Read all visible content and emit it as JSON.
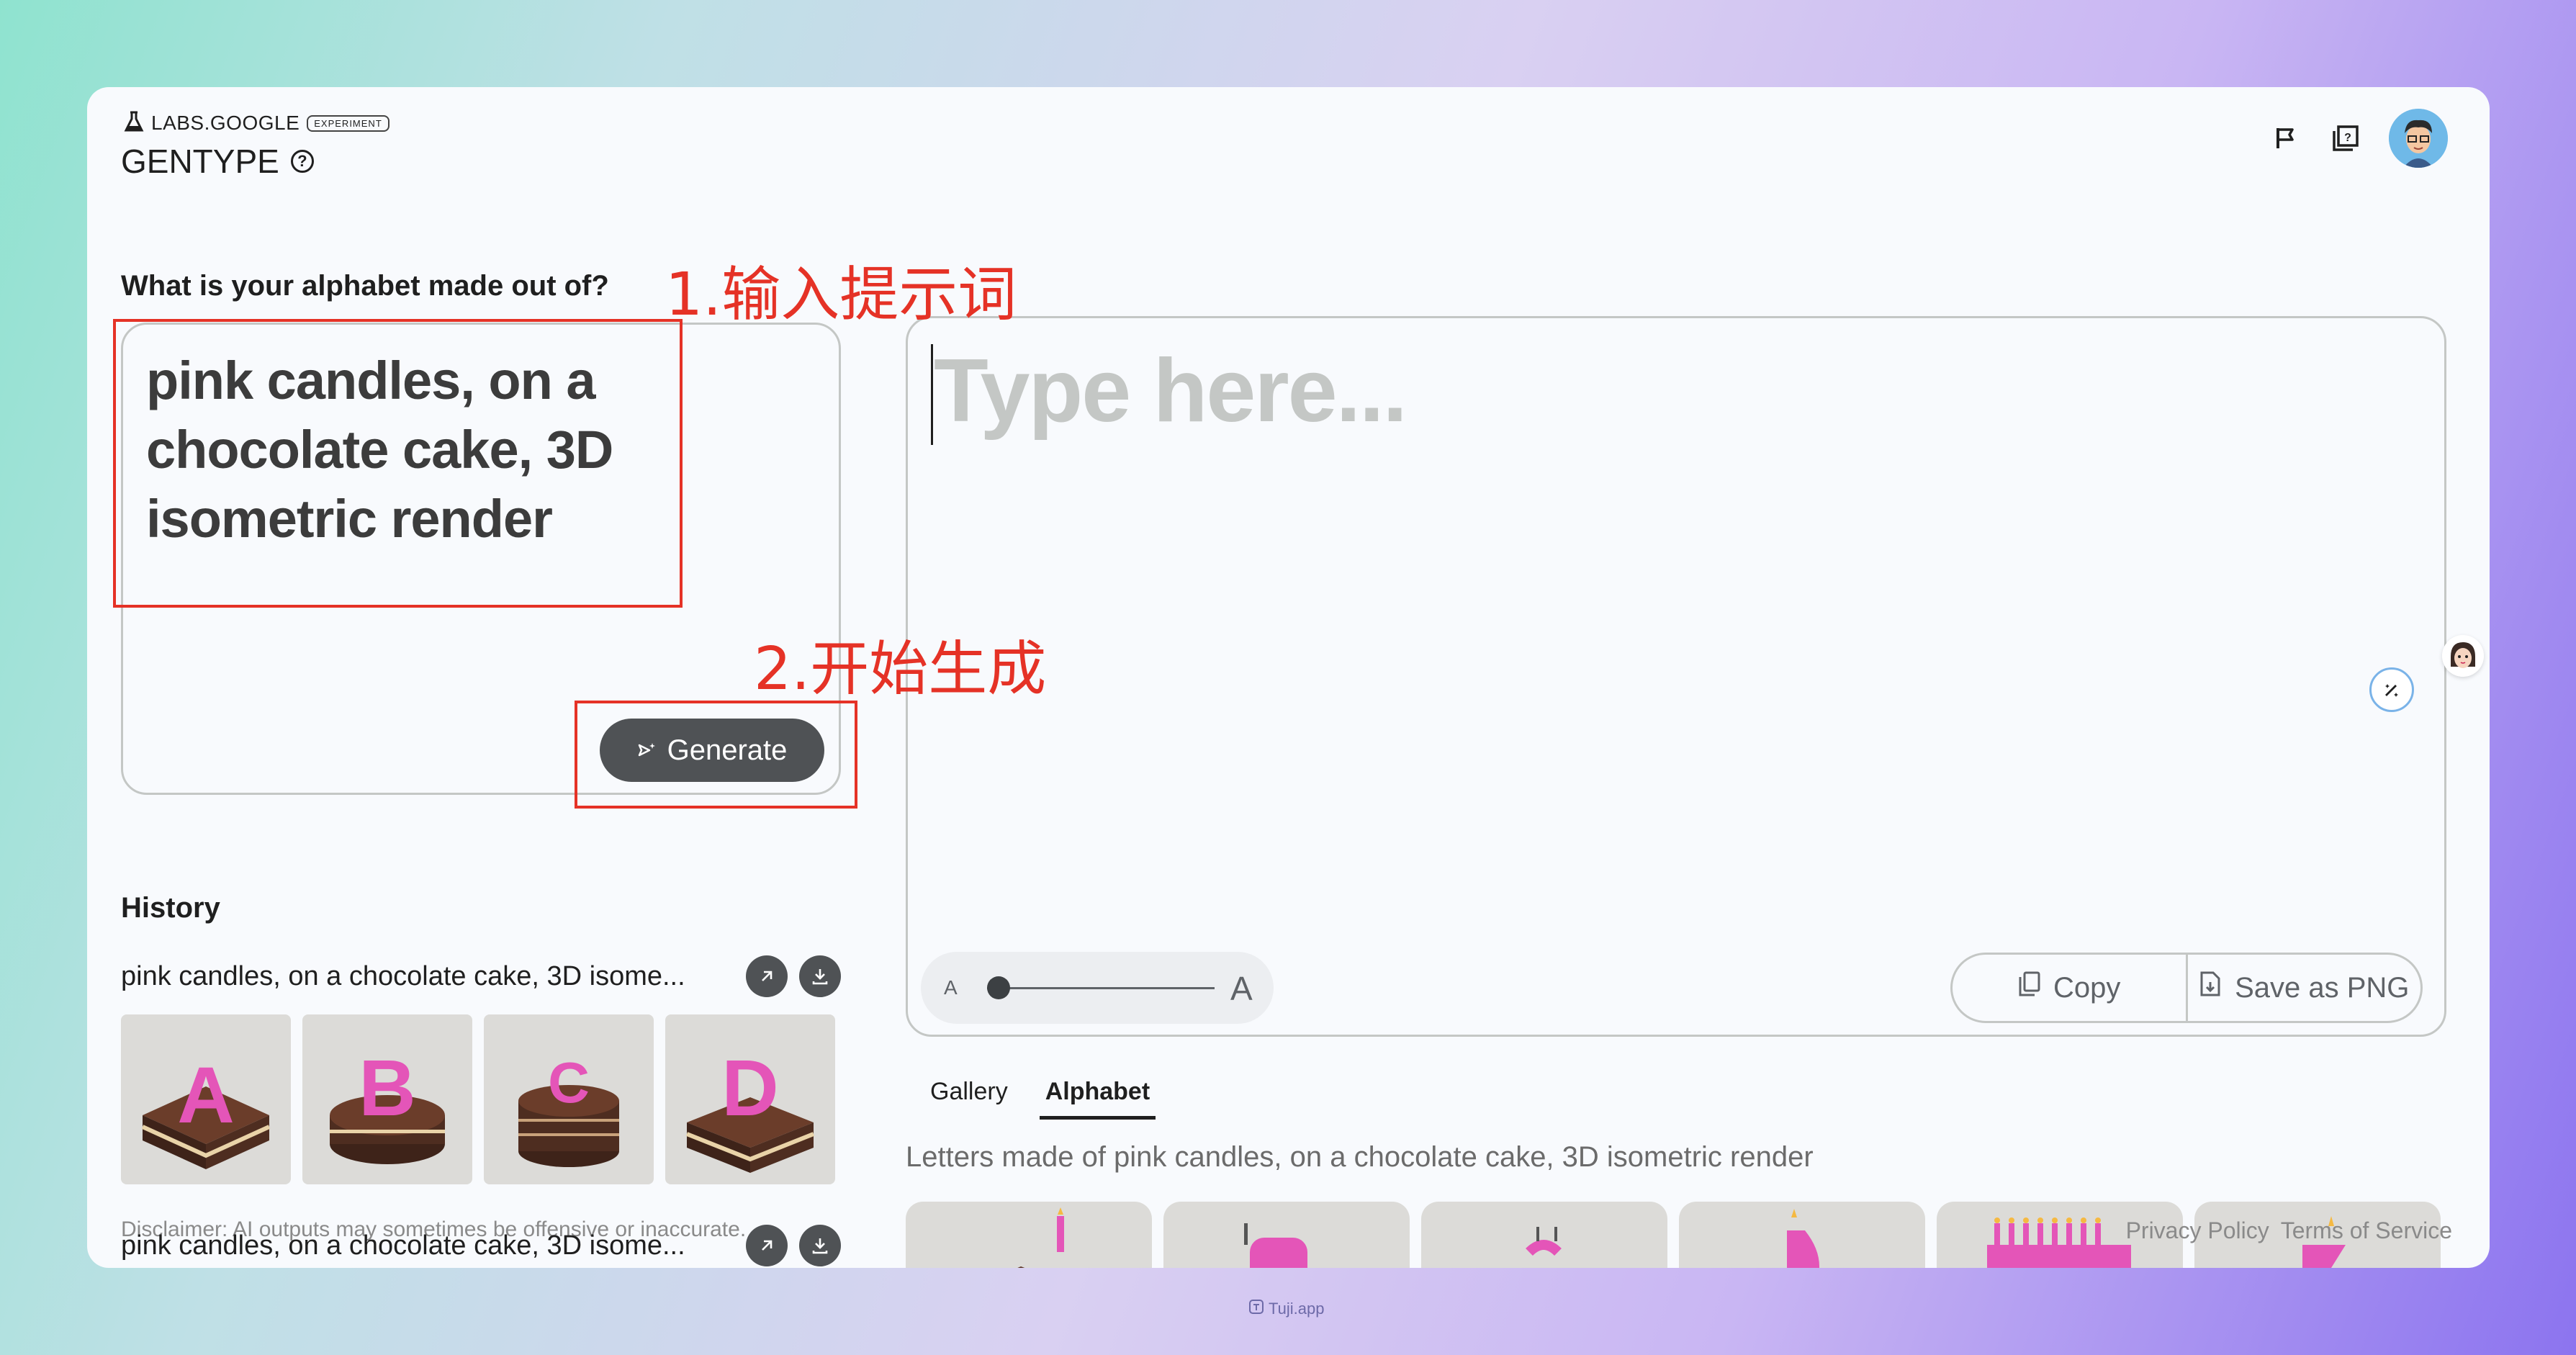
{
  "header": {
    "brand": "LABS.GOOGLE",
    "badge": "EXPERIMENT",
    "title": "GENTYPE",
    "help_symbol": "?",
    "icons": [
      "flag-icon",
      "feedback-icon",
      "user-avatar"
    ]
  },
  "prompt": {
    "label": "What is your alphabet made out of?",
    "value": "pink candles, on a chocolate cake, 3D isometric render",
    "generate_label": "Generate"
  },
  "history": {
    "label": "History",
    "entries": [
      {
        "text": "pink candles, on a chocolate cake, 3D isome..."
      },
      {
        "text": "pink candles, on a chocolate cake, 3D isome..."
      }
    ],
    "thumbs": [
      "A",
      "B",
      "C",
      "D"
    ]
  },
  "disclaimer": "Disclaimer: AI outputs may sometimes be offensive or inaccurate.",
  "canvas": {
    "placeholder": "Type here...",
    "size_small": "A",
    "size_large": "A",
    "size_level": 0.05,
    "copy_label": "Copy",
    "save_label": "Save as PNG"
  },
  "tabs": [
    {
      "label": "Gallery",
      "active": false
    },
    {
      "label": "Alphabet",
      "active": true
    }
  ],
  "letters_caption": "Letters made of pink candles, on a chocolate cake, 3D isometric render",
  "footer": {
    "privacy": "Privacy Policy",
    "terms": "Terms of Service"
  },
  "annotations": {
    "step1": "1.输入提示词",
    "step2": "2.开始生成"
  },
  "watermark": "Tuji.app",
  "colors": {
    "accent_dark": "#4f5255",
    "annotation_red": "#e53226",
    "candle_pink": "#e455b8",
    "chocolate": "#5a3424"
  }
}
